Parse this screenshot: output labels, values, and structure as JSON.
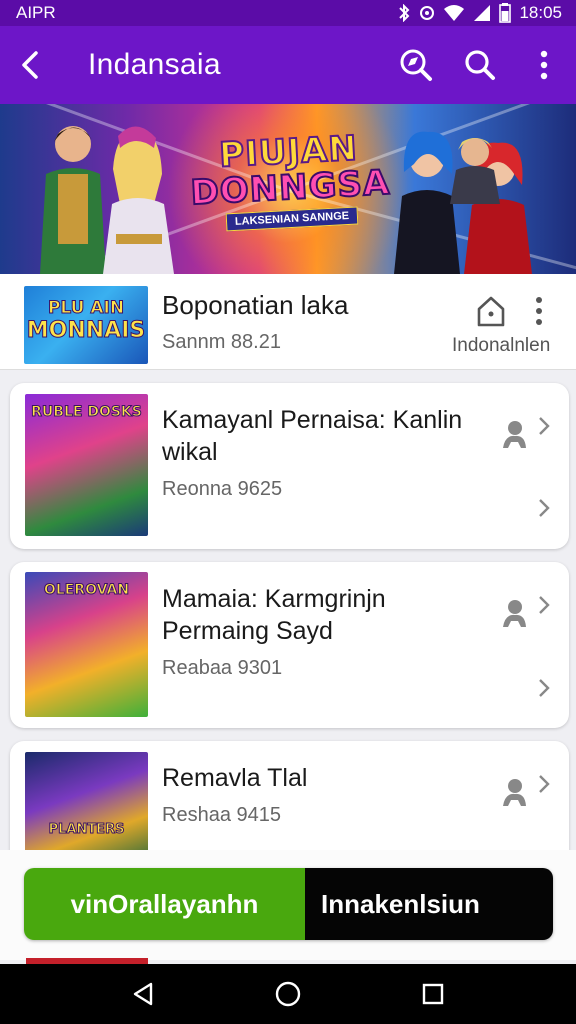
{
  "status_bar": {
    "carrier": "AIPR",
    "time": "18:05"
  },
  "app_bar": {
    "title": "Indansaia"
  },
  "banner": {
    "line1": "PIUJAN",
    "line2": "DONNGSA",
    "tagline": "LAKSENIAN SANNGE"
  },
  "info": {
    "title": "Boponatian laka",
    "subtitle": "Sannm 88.21",
    "side_label": "Indonalnlen",
    "thumb_line1": "PLU AIN",
    "thumb_line2": "MONNAIS"
  },
  "cards": [
    {
      "title": "Kamayanl Pernaisa: Kanlin wikal",
      "subtitle": "Reonna 9625",
      "thumb_text": "RUBLE DOSKS"
    },
    {
      "title": "Mamaia: Karmgrinjn Permaing Sayd",
      "subtitle": "Reabaa 9301",
      "thumb_text": "OLEROVAN"
    },
    {
      "title": "Remavla Tlal",
      "subtitle": "Reshaa 9415",
      "thumb_text": "PLANTERS"
    }
  ],
  "actions": {
    "primary": "vinOrallayanhn",
    "secondary": "Innakenlsiun"
  },
  "colors": {
    "status_bar": "#5b0ca7",
    "app_bar": "#6d16c8",
    "primary_button": "#49a80e",
    "secondary_button": "#050505"
  }
}
